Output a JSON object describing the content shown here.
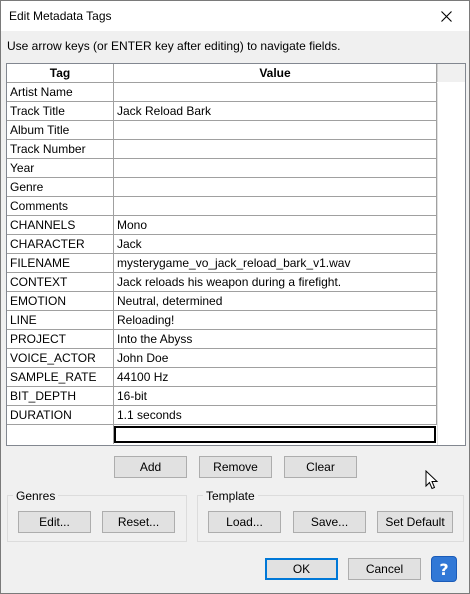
{
  "window": {
    "title": "Edit Metadata Tags"
  },
  "instructions": "Use arrow keys (or ENTER key after editing) to navigate fields.",
  "grid": {
    "headers": [
      "Tag",
      "Value"
    ],
    "rows": [
      [
        "Artist Name",
        ""
      ],
      [
        "Track Title",
        "Jack Reload Bark"
      ],
      [
        "Album Title",
        ""
      ],
      [
        "Track Number",
        ""
      ],
      [
        "Year",
        ""
      ],
      [
        "Genre",
        ""
      ],
      [
        "Comments",
        ""
      ],
      [
        "CHANNELS",
        "Mono"
      ],
      [
        "CHARACTER",
        "Jack"
      ],
      [
        "FILENAME",
        "mysterygame_vo_jack_reload_bark_v1.wav"
      ],
      [
        "CONTEXT",
        "Jack reloads his weapon during a firefight."
      ],
      [
        "EMOTION",
        "Neutral, determined"
      ],
      [
        "LINE",
        "Reloading!"
      ],
      [
        "PROJECT",
        "Into the Abyss"
      ],
      [
        "VOICE_ACTOR",
        "John Doe"
      ],
      [
        "SAMPLE_RATE",
        "44100 Hz"
      ],
      [
        "BIT_DEPTH",
        "16-bit"
      ],
      [
        "DURATION",
        "1.1 seconds"
      ]
    ]
  },
  "row_buttons": {
    "add": "Add",
    "remove": "Remove",
    "clear": "Clear"
  },
  "genres": {
    "label": "Genres",
    "edit": "Edit...",
    "reset": "Reset..."
  },
  "template": {
    "label": "Template",
    "load": "Load...",
    "save": "Save...",
    "set_default": "Set Default"
  },
  "footer": {
    "ok": "OK",
    "cancel": "Cancel",
    "help": "?"
  },
  "icons": {
    "close": "close-icon",
    "help": "help-icon",
    "cursor": "mouse-pointer-icon"
  }
}
